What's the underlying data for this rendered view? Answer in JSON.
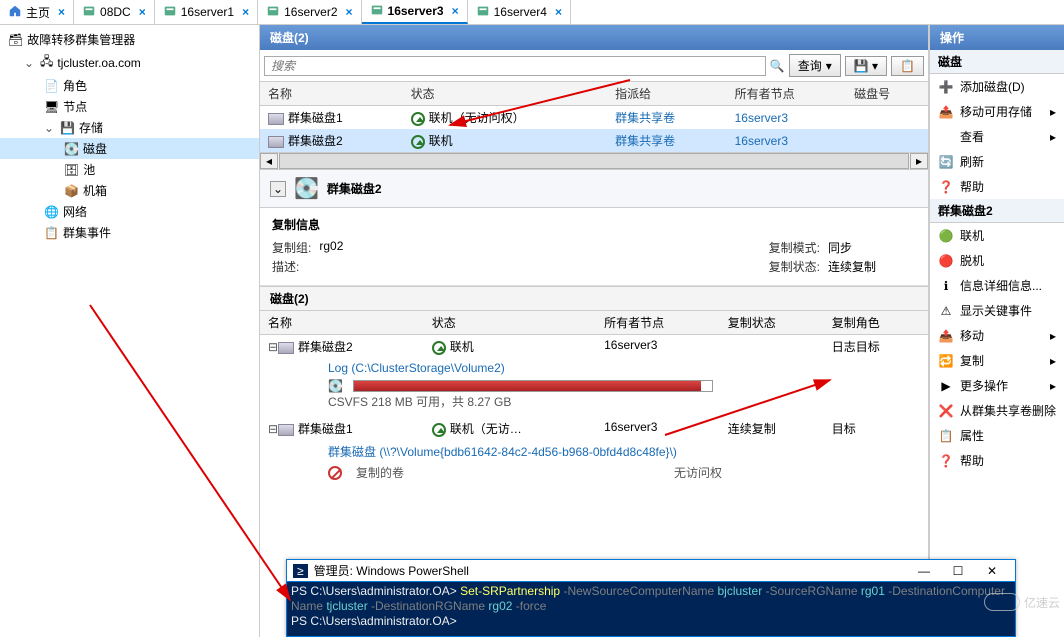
{
  "tabs": {
    "home": "主页",
    "t1": "08DC",
    "t2": "16server1",
    "t3": "16server2",
    "t4": "16server3",
    "t5": "16server4"
  },
  "tree": {
    "root": "故障转移群集管理器",
    "cluster": "tjcluster.oa.com",
    "roles": "角色",
    "nodes": "节点",
    "storage": "存储",
    "disks": "磁盘",
    "pools": "池",
    "enclosures": "机箱",
    "networks": "网络",
    "events": "群集事件"
  },
  "section": {
    "disks_title": "磁盘(2)",
    "search_ph": "搜索",
    "query": "查询"
  },
  "grid": {
    "cols": {
      "name": "名称",
      "status": "状态",
      "assigned": "指派给",
      "owner": "所有者节点",
      "diskno": "磁盘号"
    },
    "r1": {
      "name": "群集磁盘1",
      "status": "联机（无访问权）",
      "assigned": "群集共享卷",
      "owner": "16server3"
    },
    "r2": {
      "name": "群集磁盘2",
      "status": "联机",
      "assigned": "群集共享卷",
      "owner": "16server3"
    }
  },
  "detail": {
    "title": "群集磁盘2",
    "repl_info": "复制信息",
    "group_k": "复制组:",
    "group_v": "rg02",
    "desc_k": "描述:",
    "mode_k": "复制模式:",
    "mode_v": "同步",
    "rstat_k": "复制状态:",
    "rstat_v": "连续复制",
    "disks_header": "磁盘(2)",
    "cols": {
      "name": "名称",
      "status": "状态",
      "owner": "所有者节点",
      "rstat": "复制状态",
      "rrole": "复制角色"
    },
    "d1": {
      "name": "群集磁盘2",
      "status": "联机",
      "owner": "16server3",
      "role": "日志目标",
      "log": "Log (C:\\ClusterStorage\\Volume2)",
      "usage": "CSVFS 218 MB 可用，共 8.27 GB"
    },
    "d2": {
      "name": "群集磁盘1",
      "status": "联机（无访…",
      "owner": "16server3",
      "rstat": "连续复制",
      "role": "目标",
      "vol": "群集磁盘 (\\\\?\\Volume{bdb61642-84c2-4d56-b968-0bfd4d8c48fe}\\)",
      "novol": "复制的卷",
      "denied": "无访问权"
    }
  },
  "actions": {
    "header": "操作",
    "sub1": "磁盘",
    "add_disk": "添加磁盘(D)",
    "move_storage": "移动可用存储",
    "view": "查看",
    "refresh": "刷新",
    "help": "帮助",
    "sub2": "群集磁盘2",
    "online": "联机",
    "offline": "脱机",
    "info": "信息详细信息...",
    "critical": "显示关键事件",
    "move": "移动",
    "replicate": "复制",
    "more": "更多操作",
    "remove_csv": "从群集共享卷删除",
    "props": "属性",
    "help2": "帮助"
  },
  "ps": {
    "title": "管理员: Windows PowerShell",
    "prompt": "PS C:\\Users\\administrator.OA> ",
    "cmd": "Set-SRPartnership",
    "a1": " -NewSourceComputerName ",
    "v1": "bjcluster",
    "a2": " -SourceRGName ",
    "v2": "rg01",
    "a3": " -DestinationComputer",
    "line2a": "Name ",
    "line2v": "tjcluster",
    "a4": " -DestinationRGName ",
    "v4": "rg02",
    "a5": " -force"
  },
  "watermark": "亿速云"
}
